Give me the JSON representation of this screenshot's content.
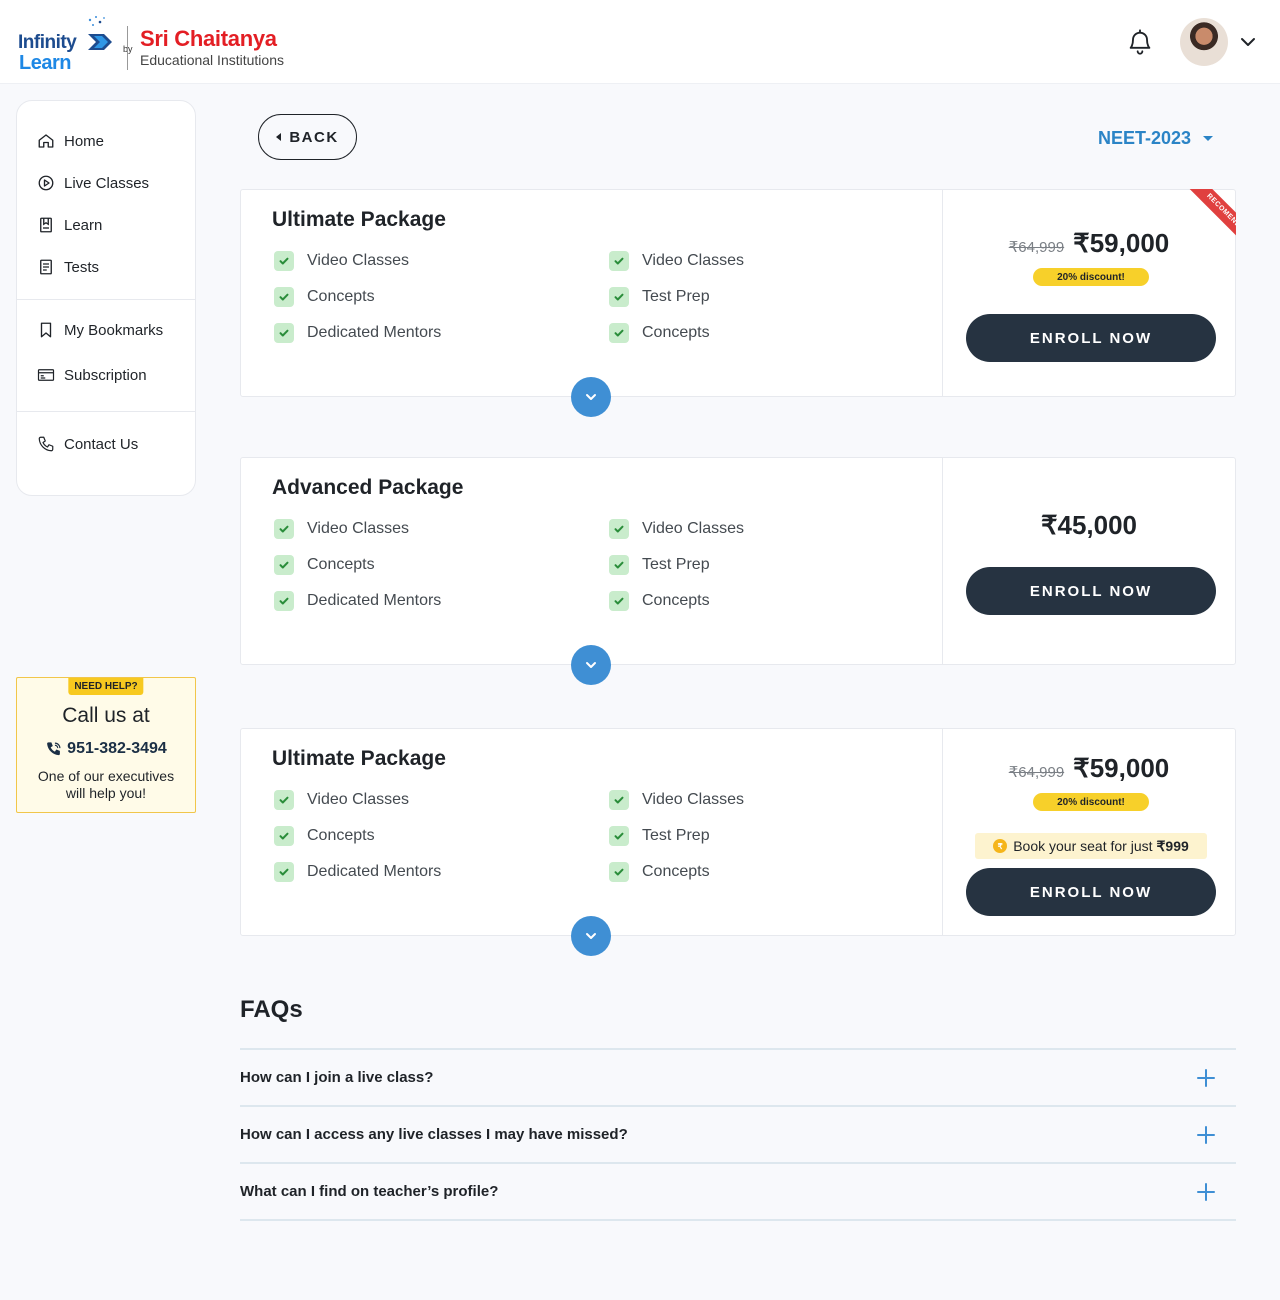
{
  "header": {
    "logo": {
      "infinity": "Infinity",
      "learn": "Learn",
      "by": "by",
      "brand": "Sri Chaitanya",
      "tagline": "Educational Institutions"
    }
  },
  "sidebar": {
    "items": [
      {
        "label": "Home",
        "icon": "home-icon"
      },
      {
        "label": "Live Classes",
        "icon": "play-circle-icon"
      },
      {
        "label": "Learn",
        "icon": "book-icon"
      },
      {
        "label": "Tests",
        "icon": "document-icon"
      },
      {
        "label": "My Bookmarks",
        "icon": "bookmark-icon"
      },
      {
        "label": "Subscription",
        "icon": "card-icon"
      },
      {
        "label": "Contact Us",
        "icon": "phone-icon"
      }
    ]
  },
  "help": {
    "badge": "NEED HELP?",
    "title": "Call us at",
    "phone": "951-382-3494",
    "text_line1": "One of our executives",
    "text_line2": "will help you!"
  },
  "toolbar": {
    "back_label": "BACK",
    "exam": "NEET-2023"
  },
  "packages": [
    {
      "title": "Ultimate Package",
      "features_left": [
        "Video Classes",
        "Concepts",
        "Dedicated Mentors"
      ],
      "features_right": [
        "Video Classes",
        "Test Prep",
        "Concepts"
      ],
      "price_old": "₹64,999",
      "price_new": "₹59,000",
      "discount": "20% discount!",
      "ribbon": "RECOMENDED",
      "enroll": "ENROLL NOW"
    },
    {
      "title": "Advanced Package",
      "features_left": [
        "Video Classes",
        "Concepts",
        "Dedicated Mentors"
      ],
      "features_right": [
        "Video Classes",
        "Test Prep",
        "Concepts"
      ],
      "price_new": "₹45,000",
      "enroll": "ENROLL NOW"
    },
    {
      "title": "Ultimate Package",
      "features_left": [
        "Video Classes",
        "Concepts",
        "Dedicated Mentors"
      ],
      "features_right": [
        "Video Classes",
        "Test Prep",
        "Concepts"
      ],
      "price_old": "₹64,999",
      "price_new": "₹59,000",
      "discount": "20% discount!",
      "book_seat": "Book your seat for just",
      "book_seat_price": "₹999",
      "enroll": "ENROLL NOW"
    }
  ],
  "faq": {
    "title": "FAQs",
    "items": [
      "How can I join a live class?",
      "How can I access any live classes I may have missed?",
      "What can I find on teacher’s profile?"
    ]
  },
  "colors": {
    "accent": "#2b84c6",
    "dark_button": "#263341",
    "discount": "#f7d02a",
    "ribbon": "#e0403f",
    "check_bg": "#c9eccc"
  }
}
